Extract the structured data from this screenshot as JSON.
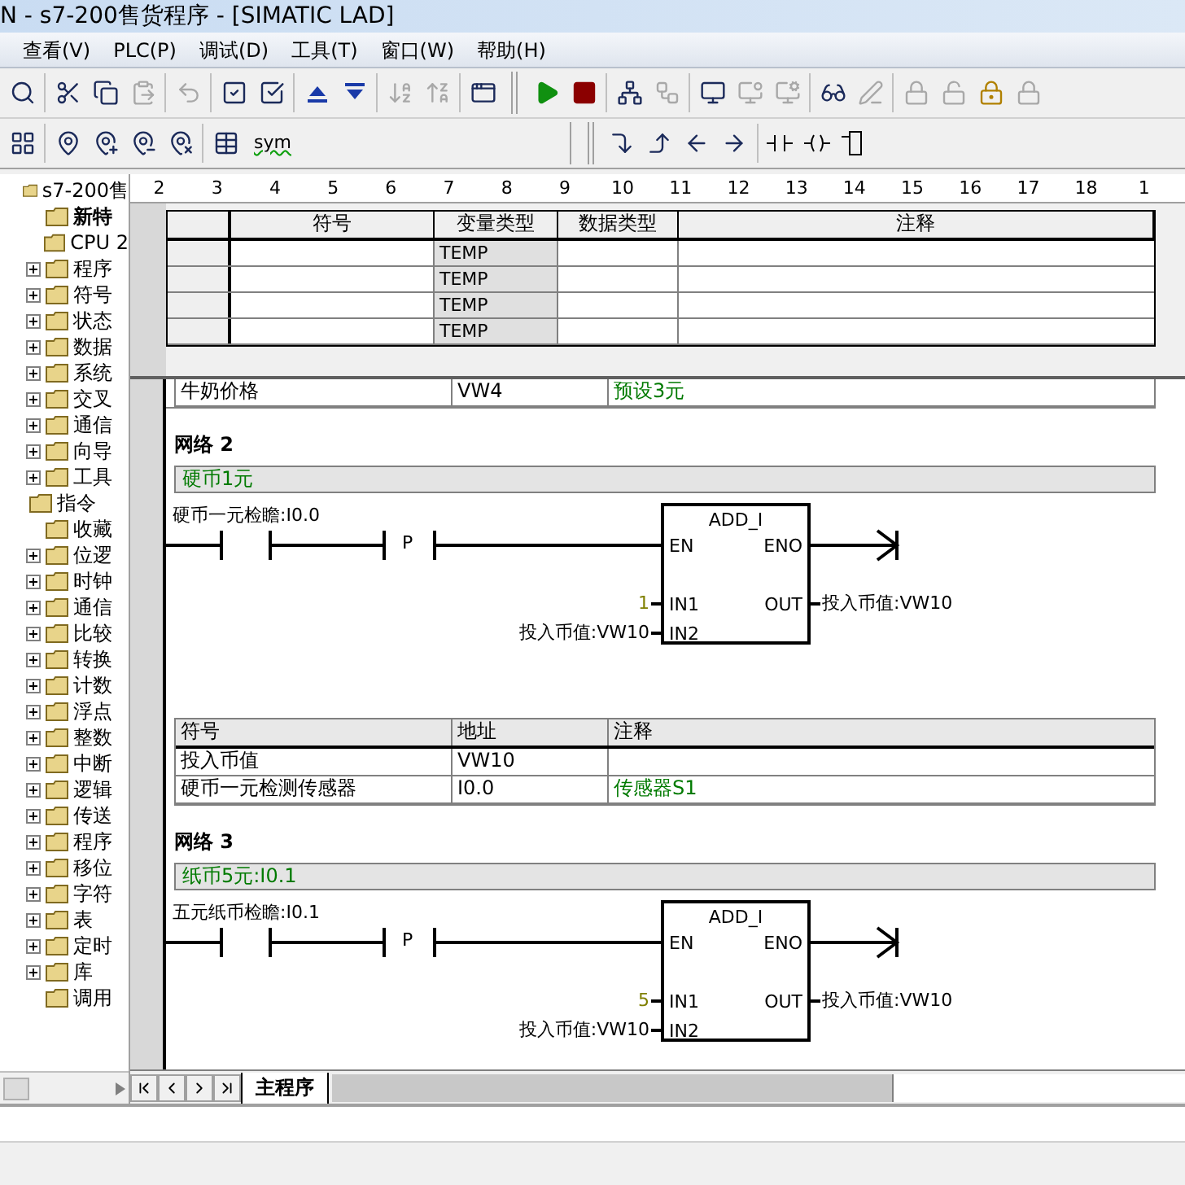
{
  "window": {
    "title": "N - s7-200售货程序 - [SIMATIC LAD]"
  },
  "menu": [
    "查看(V)",
    "PLC(P)",
    "调试(D)",
    "工具(T)",
    "窗口(W)",
    "帮助(H)"
  ],
  "toolbar": {
    "symbol_button": "sym"
  },
  "tree": [
    {
      "label": "s7-200售",
      "expandable": false,
      "children": [
        {
          "label": "新特",
          "bold": true,
          "expandable": false
        },
        {
          "label": "CPU 2",
          "expandable": false
        },
        {
          "label": "程序",
          "expandable": true
        },
        {
          "label": "符号",
          "expandable": true
        },
        {
          "label": "状态",
          "expandable": true
        },
        {
          "label": "数据",
          "expandable": true
        },
        {
          "label": "系统",
          "expandable": true
        },
        {
          "label": "交叉",
          "expandable": true
        },
        {
          "label": "通信",
          "expandable": true
        },
        {
          "label": "向导",
          "expandable": true
        },
        {
          "label": "工具",
          "expandable": true
        }
      ]
    },
    {
      "label": "指令",
      "expandable": false,
      "children": [
        {
          "label": "收藏",
          "expandable": false
        },
        {
          "label": "位逻",
          "expandable": true
        },
        {
          "label": "时钟",
          "expandable": true
        },
        {
          "label": "通信",
          "expandable": true
        },
        {
          "label": "比较",
          "expandable": true
        },
        {
          "label": "转换",
          "expandable": true
        },
        {
          "label": "计数",
          "expandable": true
        },
        {
          "label": "浮点",
          "expandable": true
        },
        {
          "label": "整数",
          "expandable": true
        },
        {
          "label": "中断",
          "expandable": true
        },
        {
          "label": "逻辑",
          "expandable": true
        },
        {
          "label": "传送",
          "expandable": true
        },
        {
          "label": "程序",
          "expandable": true
        },
        {
          "label": "移位",
          "expandable": true
        },
        {
          "label": "字符",
          "expandable": true
        },
        {
          "label": "表",
          "expandable": true
        },
        {
          "label": "定时",
          "expandable": true
        },
        {
          "label": "库",
          "expandable": true
        },
        {
          "label": "调用",
          "expandable": false
        }
      ]
    }
  ],
  "ruler": [
    "2",
    "3",
    "4",
    "5",
    "6",
    "7",
    "8",
    "9",
    "10",
    "11",
    "12",
    "13",
    "14",
    "15",
    "16",
    "17",
    "18",
    "1"
  ],
  "locals": {
    "columns": [
      "符号",
      "变量类型",
      "数据类型",
      "注释"
    ],
    "rows": [
      {
        "var_type": "TEMP"
      },
      {
        "var_type": "TEMP"
      },
      {
        "var_type": "TEMP"
      },
      {
        "var_type": "TEMP"
      }
    ]
  },
  "prev_symbol_row": {
    "symbol": "牛奶价格",
    "address": "VW4",
    "comment": "预设3元"
  },
  "networks": [
    {
      "title": "网络 2",
      "comment": "硬币1元",
      "contact_label": "硬币一元检瞻:I0.0",
      "edge": "P",
      "block": {
        "name": "ADD_I",
        "en": "EN",
        "eno": "ENO",
        "in1_pin": "IN1",
        "in2_pin": "IN2",
        "out_pin": "OUT",
        "in1": "1",
        "in2": "投入币值:VW10",
        "out": "投入币值:VW10"
      },
      "symbols": {
        "columns": [
          "符号",
          "地址",
          "注释"
        ],
        "rows": [
          {
            "symbol": "投入币值",
            "address": "VW10"
          },
          {
            "symbol": "硬币一元检测传感器",
            "address": "I0.0",
            "comment": "传感器S1"
          }
        ]
      }
    },
    {
      "title": "网络 3",
      "comment": "纸币5元:I0.1",
      "contact_label": "五元纸币检瞻:I0.1",
      "edge": "P",
      "block": {
        "name": "ADD_I",
        "en": "EN",
        "eno": "ENO",
        "in1_pin": "IN1",
        "in2_pin": "IN2",
        "out_pin": "OUT",
        "in1": "5",
        "in2": "投入币值:VW10",
        "out": "投入币值:VW10"
      }
    }
  ],
  "tabs": [
    {
      "label": "主程序",
      "selected": true
    }
  ]
}
